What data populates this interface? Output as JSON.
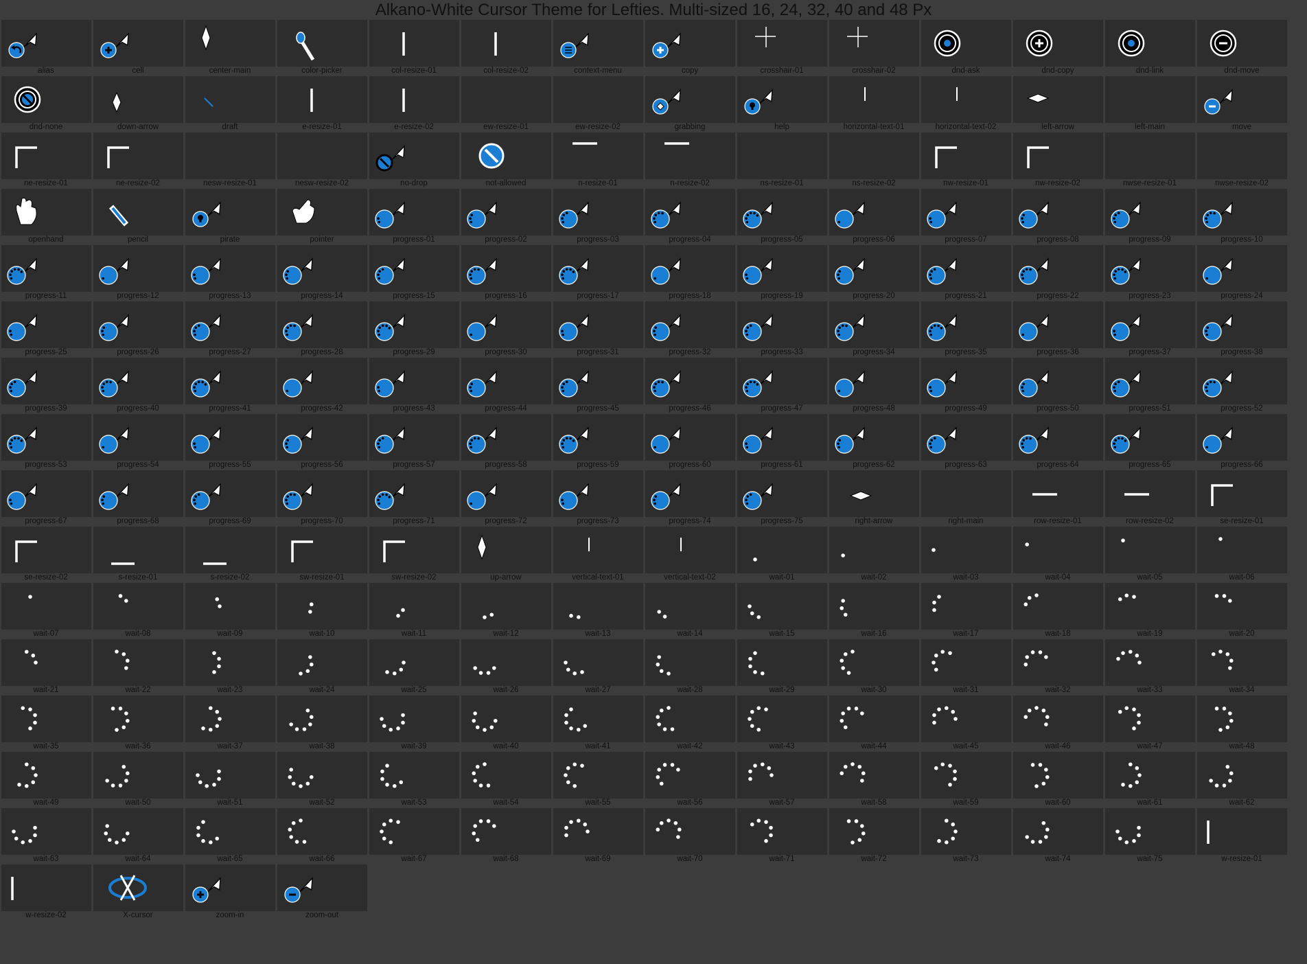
{
  "title": "Alkano-White Cursor Theme for Lefties. Multi-sized 16, 24, 32, 40 and 48 Px",
  "colors": {
    "background": "#3c3c3c",
    "tile": "#2d2d2d",
    "label": "#101010",
    "accent": "#1a7fd4",
    "cursor": "#ffffff"
  },
  "cursors": [
    {
      "name": "alias",
      "icon": "arrow-with-curved-back-arrow-badge-icon"
    },
    {
      "name": "cell",
      "icon": "arrow-with-plus-badge-icon"
    },
    {
      "name": "center-main",
      "icon": "diamond-arrow-icon"
    },
    {
      "name": "color-picker",
      "icon": "eyedropper-icon"
    },
    {
      "name": "col-resize-01",
      "icon": "col-resize-icon"
    },
    {
      "name": "col-resize-02",
      "icon": "col-resize-icon"
    },
    {
      "name": "context-menu",
      "icon": "arrow-with-menu-badge-icon"
    },
    {
      "name": "copy",
      "icon": "arrow-with-plus-badge-icon"
    },
    {
      "name": "crosshair-01",
      "icon": "crosshair-arrow-icon"
    },
    {
      "name": "crosshair-02",
      "icon": "crosshair-arrow-icon"
    },
    {
      "name": "dnd-ask",
      "icon": "dnd-question-icon"
    },
    {
      "name": "dnd-copy",
      "icon": "dnd-plus-icon"
    },
    {
      "name": "dnd-link",
      "icon": "dnd-link-icon"
    },
    {
      "name": "dnd-move",
      "icon": "dnd-minus-icon"
    },
    {
      "name": "dnd-none",
      "icon": "dnd-forbidden-icon"
    },
    {
      "name": "down-arrow",
      "icon": "down-arrow-icon"
    },
    {
      "name": "draft",
      "icon": "draft-pen-icon"
    },
    {
      "name": "e-resize-01",
      "icon": "e-resize-icon"
    },
    {
      "name": "e-resize-02",
      "icon": "e-resize-icon"
    },
    {
      "name": "ew-resize-01",
      "icon": "ew-resize-icon"
    },
    {
      "name": "ew-resize-02",
      "icon": "ew-resize-icon"
    },
    {
      "name": "grabbing",
      "icon": "arrow-with-move-badge-icon"
    },
    {
      "name": "help",
      "icon": "arrow-with-question-badge-icon"
    },
    {
      "name": "horizontal-text-01",
      "icon": "text-beam-arrow-icon"
    },
    {
      "name": "horizontal-text-02",
      "icon": "text-beam-arrow-icon"
    },
    {
      "name": "left-arrow",
      "icon": "left-arrow-icon"
    },
    {
      "name": "left-main",
      "icon": "left-pointer-icon"
    },
    {
      "name": "move",
      "icon": "arrow-with-minus-badge-icon"
    },
    {
      "name": "ne-resize-01",
      "icon": "corner-resize-icon"
    },
    {
      "name": "ne-resize-02",
      "icon": "corner-resize-icon"
    },
    {
      "name": "nesw-resize-01",
      "icon": "diagonal-resize-icon"
    },
    {
      "name": "nesw-resize-02",
      "icon": "diagonal-resize-icon"
    },
    {
      "name": "no-drop",
      "icon": "arrow-with-forbidden-badge-icon"
    },
    {
      "name": "not-allowed",
      "icon": "forbidden-icon"
    },
    {
      "name": "n-resize-01",
      "icon": "n-resize-icon"
    },
    {
      "name": "n-resize-02",
      "icon": "n-resize-icon"
    },
    {
      "name": "ns-resize-01",
      "icon": "ns-resize-icon"
    },
    {
      "name": "ns-resize-02",
      "icon": "ns-resize-icon"
    },
    {
      "name": "nw-resize-01",
      "icon": "corner-resize-icon"
    },
    {
      "name": "nw-resize-02",
      "icon": "corner-resize-icon"
    },
    {
      "name": "nwse-resize-01",
      "icon": "diagonal-resize-icon"
    },
    {
      "name": "nwse-resize-02",
      "icon": "diagonal-resize-icon"
    },
    {
      "name": "openhand",
      "icon": "open-hand-icon"
    },
    {
      "name": "pencil",
      "icon": "pencil-icon"
    },
    {
      "name": "pirate",
      "icon": "arrow-with-skull-badge-icon"
    },
    {
      "name": "pointer",
      "icon": "pointing-hand-icon"
    },
    {
      "name": "progress-01",
      "icon": "progress-arrow-icon"
    },
    {
      "name": "progress-02",
      "icon": "progress-arrow-icon"
    },
    {
      "name": "progress-03",
      "icon": "progress-arrow-icon"
    },
    {
      "name": "progress-04",
      "icon": "progress-arrow-icon"
    },
    {
      "name": "progress-05",
      "icon": "progress-arrow-icon"
    },
    {
      "name": "progress-06",
      "icon": "progress-arrow-icon"
    },
    {
      "name": "progress-07",
      "icon": "progress-arrow-icon"
    },
    {
      "name": "progress-08",
      "icon": "progress-arrow-icon"
    },
    {
      "name": "progress-09",
      "icon": "progress-arrow-icon"
    },
    {
      "name": "progress-10",
      "icon": "progress-arrow-icon"
    },
    {
      "name": "progress-11",
      "icon": "progress-arrow-icon"
    },
    {
      "name": "progress-12",
      "icon": "progress-arrow-icon"
    },
    {
      "name": "progress-13",
      "icon": "progress-arrow-icon"
    },
    {
      "name": "progress-14",
      "icon": "progress-arrow-icon"
    },
    {
      "name": "progress-15",
      "icon": "progress-arrow-icon"
    },
    {
      "name": "progress-16",
      "icon": "progress-arrow-icon"
    },
    {
      "name": "progress-17",
      "icon": "progress-arrow-icon"
    },
    {
      "name": "progress-18",
      "icon": "progress-arrow-icon"
    },
    {
      "name": "progress-19",
      "icon": "progress-arrow-icon"
    },
    {
      "name": "progress-20",
      "icon": "progress-arrow-icon"
    },
    {
      "name": "progress-21",
      "icon": "progress-arrow-icon"
    },
    {
      "name": "progress-22",
      "icon": "progress-arrow-icon"
    },
    {
      "name": "progress-23",
      "icon": "progress-arrow-icon"
    },
    {
      "name": "progress-24",
      "icon": "progress-arrow-icon"
    },
    {
      "name": "progress-25",
      "icon": "progress-arrow-icon"
    },
    {
      "name": "progress-26",
      "icon": "progress-arrow-icon"
    },
    {
      "name": "progress-27",
      "icon": "progress-arrow-icon"
    },
    {
      "name": "progress-28",
      "icon": "progress-arrow-icon"
    },
    {
      "name": "progress-29",
      "icon": "progress-arrow-icon"
    },
    {
      "name": "progress-30",
      "icon": "progress-arrow-icon"
    },
    {
      "name": "progress-31",
      "icon": "progress-arrow-icon"
    },
    {
      "name": "progress-32",
      "icon": "progress-arrow-icon"
    },
    {
      "name": "progress-33",
      "icon": "progress-arrow-icon"
    },
    {
      "name": "progress-34",
      "icon": "progress-arrow-icon"
    },
    {
      "name": "progress-35",
      "icon": "progress-arrow-icon"
    },
    {
      "name": "progress-36",
      "icon": "progress-arrow-icon"
    },
    {
      "name": "progress-37",
      "icon": "progress-arrow-icon"
    },
    {
      "name": "progress-38",
      "icon": "progress-arrow-icon"
    },
    {
      "name": "progress-39",
      "icon": "progress-arrow-icon"
    },
    {
      "name": "progress-40",
      "icon": "progress-arrow-icon"
    },
    {
      "name": "progress-41",
      "icon": "progress-arrow-icon"
    },
    {
      "name": "progress-42",
      "icon": "progress-arrow-icon"
    },
    {
      "name": "progress-43",
      "icon": "progress-arrow-icon"
    },
    {
      "name": "progress-44",
      "icon": "progress-arrow-icon"
    },
    {
      "name": "progress-45",
      "icon": "progress-arrow-icon"
    },
    {
      "name": "progress-46",
      "icon": "progress-arrow-icon"
    },
    {
      "name": "progress-47",
      "icon": "progress-arrow-icon"
    },
    {
      "name": "progress-48",
      "icon": "progress-arrow-icon"
    },
    {
      "name": "progress-49",
      "icon": "progress-arrow-icon"
    },
    {
      "name": "progress-50",
      "icon": "progress-arrow-icon"
    },
    {
      "name": "progress-51",
      "icon": "progress-arrow-icon"
    },
    {
      "name": "progress-52",
      "icon": "progress-arrow-icon"
    },
    {
      "name": "progress-53",
      "icon": "progress-arrow-icon"
    },
    {
      "name": "progress-54",
      "icon": "progress-arrow-icon"
    },
    {
      "name": "progress-55",
      "icon": "progress-arrow-icon"
    },
    {
      "name": "progress-56",
      "icon": "progress-arrow-icon"
    },
    {
      "name": "progress-57",
      "icon": "progress-arrow-icon"
    },
    {
      "name": "progress-58",
      "icon": "progress-arrow-icon"
    },
    {
      "name": "progress-59",
      "icon": "progress-arrow-icon"
    },
    {
      "name": "progress-60",
      "icon": "progress-arrow-icon"
    },
    {
      "name": "progress-61",
      "icon": "progress-arrow-icon"
    },
    {
      "name": "progress-62",
      "icon": "progress-arrow-icon"
    },
    {
      "name": "progress-63",
      "icon": "progress-arrow-icon"
    },
    {
      "name": "progress-64",
      "icon": "progress-arrow-icon"
    },
    {
      "name": "progress-65",
      "icon": "progress-arrow-icon"
    },
    {
      "name": "progress-66",
      "icon": "progress-arrow-icon"
    },
    {
      "name": "progress-67",
      "icon": "progress-arrow-icon"
    },
    {
      "name": "progress-68",
      "icon": "progress-arrow-icon"
    },
    {
      "name": "progress-69",
      "icon": "progress-arrow-icon"
    },
    {
      "name": "progress-70",
      "icon": "progress-arrow-icon"
    },
    {
      "name": "progress-71",
      "icon": "progress-arrow-icon"
    },
    {
      "name": "progress-72",
      "icon": "progress-arrow-icon"
    },
    {
      "name": "progress-73",
      "icon": "progress-arrow-icon"
    },
    {
      "name": "progress-74",
      "icon": "progress-arrow-icon"
    },
    {
      "name": "progress-75",
      "icon": "progress-arrow-icon"
    },
    {
      "name": "right-arrow",
      "icon": "right-arrow-icon"
    },
    {
      "name": "right-main",
      "icon": "right-pointer-icon"
    },
    {
      "name": "row-resize-01",
      "icon": "row-resize-icon"
    },
    {
      "name": "row-resize-02",
      "icon": "row-resize-icon"
    },
    {
      "name": "se-resize-01",
      "icon": "corner-resize-icon"
    },
    {
      "name": "se-resize-02",
      "icon": "corner-resize-icon"
    },
    {
      "name": "s-resize-01",
      "icon": "s-resize-icon"
    },
    {
      "name": "s-resize-02",
      "icon": "s-resize-icon"
    },
    {
      "name": "sw-resize-01",
      "icon": "corner-resize-icon"
    },
    {
      "name": "sw-resize-02",
      "icon": "corner-resize-icon"
    },
    {
      "name": "up-arrow",
      "icon": "up-arrow-icon"
    },
    {
      "name": "vertical-text-01",
      "icon": "vertical-text-arrow-icon"
    },
    {
      "name": "vertical-text-02",
      "icon": "vertical-text-arrow-icon"
    },
    {
      "name": "wait-01",
      "icon": "wait-dots-icon"
    },
    {
      "name": "wait-02",
      "icon": "wait-dots-icon"
    },
    {
      "name": "wait-03",
      "icon": "wait-dots-icon"
    },
    {
      "name": "wait-04",
      "icon": "wait-dots-icon"
    },
    {
      "name": "wait-05",
      "icon": "wait-dots-icon"
    },
    {
      "name": "wait-06",
      "icon": "wait-dots-icon"
    },
    {
      "name": "wait-07",
      "icon": "wait-dots-icon"
    },
    {
      "name": "wait-08",
      "icon": "wait-dots-icon"
    },
    {
      "name": "wait-09",
      "icon": "wait-dots-icon"
    },
    {
      "name": "wait-10",
      "icon": "wait-dots-icon"
    },
    {
      "name": "wait-11",
      "icon": "wait-dots-icon"
    },
    {
      "name": "wait-12",
      "icon": "wait-dots-icon"
    },
    {
      "name": "wait-13",
      "icon": "wait-dots-icon"
    },
    {
      "name": "wait-14",
      "icon": "wait-dots-icon"
    },
    {
      "name": "wait-15",
      "icon": "wait-dots-icon"
    },
    {
      "name": "wait-16",
      "icon": "wait-dots-icon"
    },
    {
      "name": "wait-17",
      "icon": "wait-dots-icon"
    },
    {
      "name": "wait-18",
      "icon": "wait-dots-icon"
    },
    {
      "name": "wait-19",
      "icon": "wait-dots-icon"
    },
    {
      "name": "wait-20",
      "icon": "wait-dots-icon"
    },
    {
      "name": "wait-21",
      "icon": "wait-dots-icon"
    },
    {
      "name": "wait-22",
      "icon": "wait-dots-icon"
    },
    {
      "name": "wait-23",
      "icon": "wait-dots-icon"
    },
    {
      "name": "wait-24",
      "icon": "wait-dots-icon"
    },
    {
      "name": "wait-25",
      "icon": "wait-dots-icon"
    },
    {
      "name": "wait-26",
      "icon": "wait-dots-icon"
    },
    {
      "name": "wait-27",
      "icon": "wait-dots-icon"
    },
    {
      "name": "wait-28",
      "icon": "wait-dots-icon"
    },
    {
      "name": "wait-29",
      "icon": "wait-dots-icon"
    },
    {
      "name": "wait-30",
      "icon": "wait-dots-icon"
    },
    {
      "name": "wait-31",
      "icon": "wait-dots-icon"
    },
    {
      "name": "wait-32",
      "icon": "wait-dots-icon"
    },
    {
      "name": "wait-33",
      "icon": "wait-dots-icon"
    },
    {
      "name": "wait-34",
      "icon": "wait-dots-icon"
    },
    {
      "name": "wait-35",
      "icon": "wait-dots-icon"
    },
    {
      "name": "wait-36",
      "icon": "wait-dots-icon"
    },
    {
      "name": "wait-37",
      "icon": "wait-dots-icon"
    },
    {
      "name": "wait-38",
      "icon": "wait-dots-icon"
    },
    {
      "name": "wait-39",
      "icon": "wait-dots-icon"
    },
    {
      "name": "wait-40",
      "icon": "wait-dots-icon"
    },
    {
      "name": "wait-41",
      "icon": "wait-dots-icon"
    },
    {
      "name": "wait-42",
      "icon": "wait-dots-icon"
    },
    {
      "name": "wait-43",
      "icon": "wait-dots-icon"
    },
    {
      "name": "wait-44",
      "icon": "wait-dots-icon"
    },
    {
      "name": "wait-45",
      "icon": "wait-dots-icon"
    },
    {
      "name": "wait-46",
      "icon": "wait-dots-icon"
    },
    {
      "name": "wait-47",
      "icon": "wait-dots-icon"
    },
    {
      "name": "wait-48",
      "icon": "wait-dots-icon"
    },
    {
      "name": "wait-49",
      "icon": "wait-dots-icon"
    },
    {
      "name": "wait-50",
      "icon": "wait-dots-icon"
    },
    {
      "name": "wait-51",
      "icon": "wait-dots-icon"
    },
    {
      "name": "wait-52",
      "icon": "wait-dots-icon"
    },
    {
      "name": "wait-53",
      "icon": "wait-dots-icon"
    },
    {
      "name": "wait-54",
      "icon": "wait-dots-icon"
    },
    {
      "name": "wait-55",
      "icon": "wait-dots-icon"
    },
    {
      "name": "wait-56",
      "icon": "wait-dots-icon"
    },
    {
      "name": "wait-57",
      "icon": "wait-dots-icon"
    },
    {
      "name": "wait-58",
      "icon": "wait-dots-icon"
    },
    {
      "name": "wait-59",
      "icon": "wait-dots-icon"
    },
    {
      "name": "wait-60",
      "icon": "wait-dots-icon"
    },
    {
      "name": "wait-61",
      "icon": "wait-dots-icon"
    },
    {
      "name": "wait-62",
      "icon": "wait-dots-icon"
    },
    {
      "name": "wait-63",
      "icon": "wait-dots-icon"
    },
    {
      "name": "wait-64",
      "icon": "wait-dots-icon"
    },
    {
      "name": "wait-65",
      "icon": "wait-dots-icon"
    },
    {
      "name": "wait-66",
      "icon": "wait-dots-icon"
    },
    {
      "name": "wait-67",
      "icon": "wait-dots-icon"
    },
    {
      "name": "wait-68",
      "icon": "wait-dots-icon"
    },
    {
      "name": "wait-69",
      "icon": "wait-dots-icon"
    },
    {
      "name": "wait-70",
      "icon": "wait-dots-icon"
    },
    {
      "name": "wait-71",
      "icon": "wait-dots-icon"
    },
    {
      "name": "wait-72",
      "icon": "wait-dots-icon"
    },
    {
      "name": "wait-73",
      "icon": "wait-dots-icon"
    },
    {
      "name": "wait-74",
      "icon": "wait-dots-icon"
    },
    {
      "name": "wait-75",
      "icon": "wait-dots-icon"
    },
    {
      "name": "w-resize-01",
      "icon": "w-resize-icon"
    },
    {
      "name": "w-resize-02",
      "icon": "w-resize-icon"
    },
    {
      "name": "X-cursor",
      "icon": "x-cursor-icon"
    },
    {
      "name": "zoom-in",
      "icon": "arrow-with-plus-badge-icon"
    },
    {
      "name": "zoom-out",
      "icon": "arrow-with-minus-badge-icon"
    }
  ]
}
